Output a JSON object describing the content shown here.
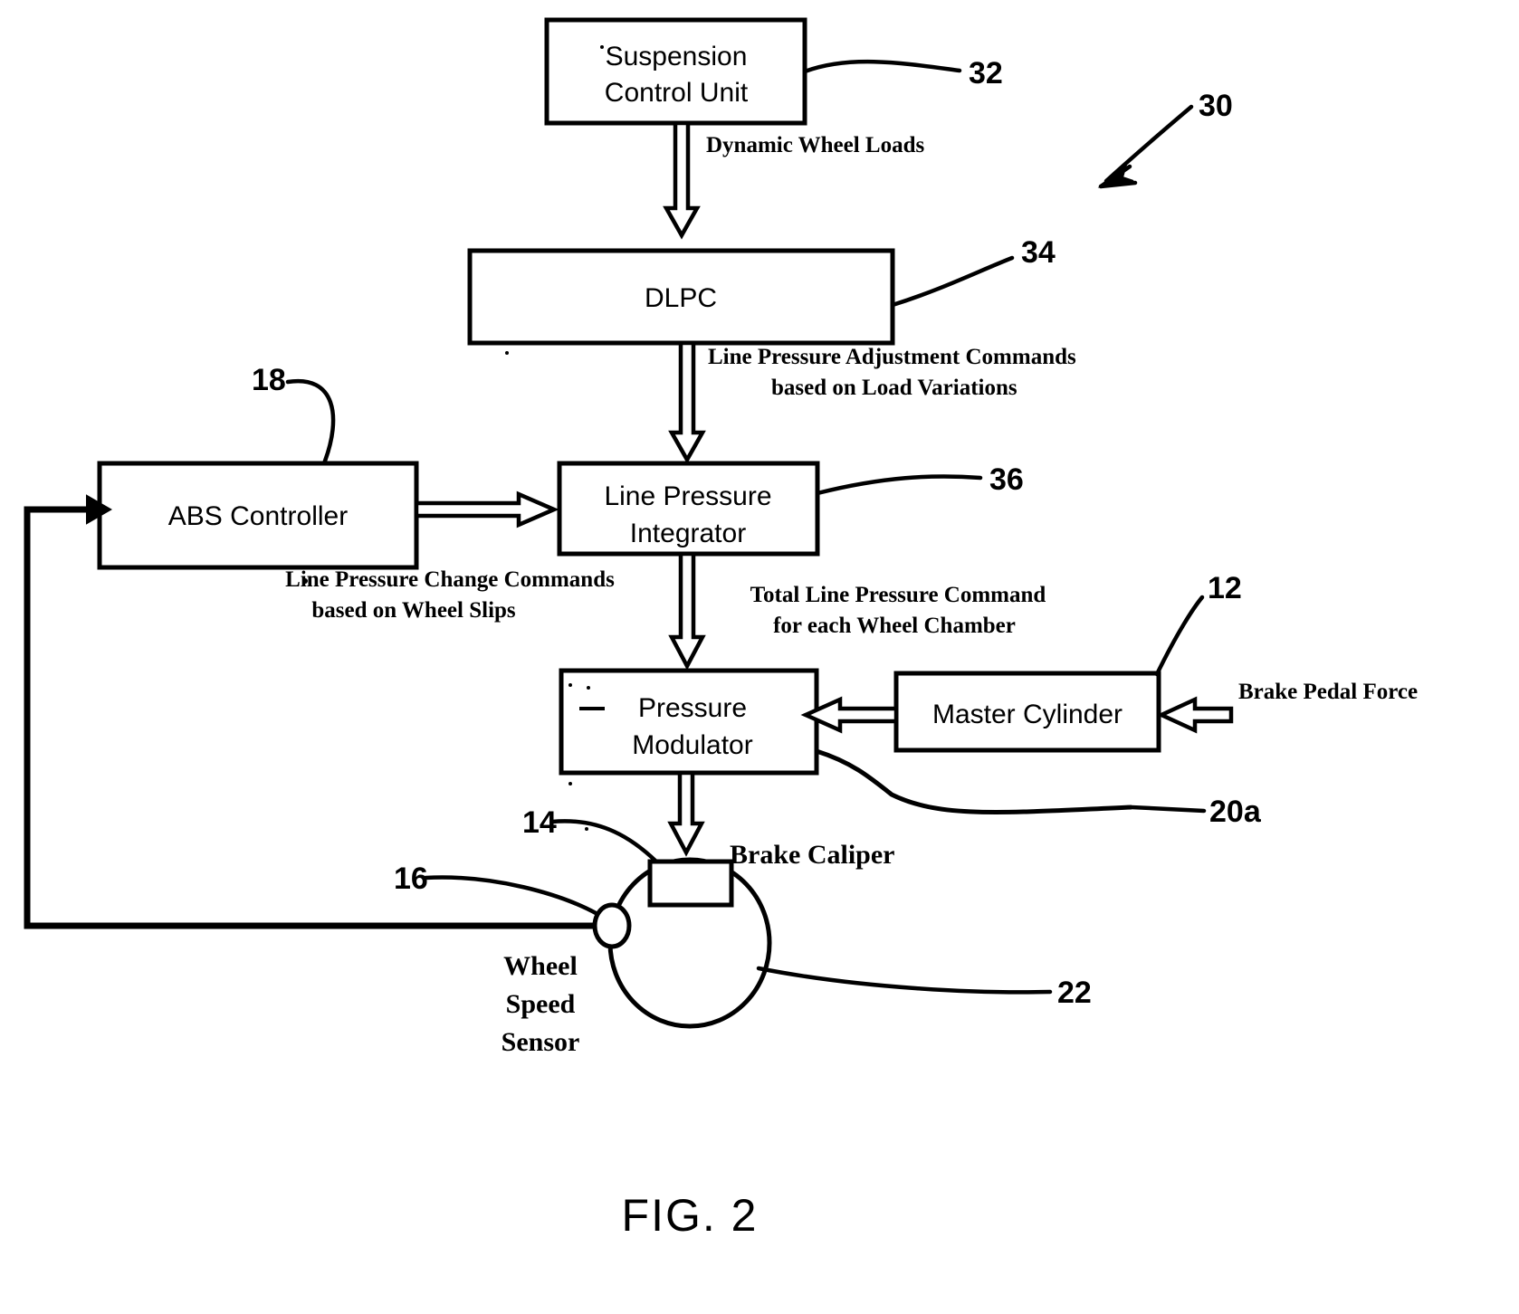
{
  "figure": {
    "caption": "FIG. 2",
    "overall_ref": "30"
  },
  "blocks": [
    {
      "id": "suspension-control-unit",
      "label_line1": "Suspension",
      "label_line2": "Control Unit",
      "ref": "32"
    },
    {
      "id": "dlpc",
      "label_line1": "DLPC",
      "label_line2": "",
      "ref": "34"
    },
    {
      "id": "abs-controller",
      "label_line1": "ABS Controller",
      "label_line2": "",
      "ref": "18"
    },
    {
      "id": "line-pressure-integrator",
      "label_line1": "Line Pressure",
      "label_line2": "Integrator",
      "ref": "36"
    },
    {
      "id": "pressure-modulator",
      "label_line1": "Pressure",
      "label_line2": "Modulator",
      "ref": ""
    },
    {
      "id": "master-cylinder",
      "label_line1": "Master Cylinder",
      "label_line2": "",
      "ref": "12"
    }
  ],
  "flows": [
    {
      "id": "dynamic-wheel-loads",
      "line1": "Dynamic Wheel Loads",
      "line2": ""
    },
    {
      "id": "line-pressure-adjustment",
      "line1": "Line Pressure Adjustment Commands",
      "line2": "based on Load Variations"
    },
    {
      "id": "line-pressure-change",
      "line1": "Line Pressure Change Commands",
      "line2": "based on Wheel Slips"
    },
    {
      "id": "total-line-pressure",
      "line1": "Total Line Pressure Command",
      "line2": "for each Wheel Chamber"
    },
    {
      "id": "brake-pedal-force",
      "line1": "Brake Pedal Force",
      "line2": ""
    }
  ],
  "components": {
    "brake_caliper": {
      "label": "Brake Caliper",
      "ref": "14"
    },
    "wheel_speed_sensor": {
      "label_line1": "Wheel",
      "label_line2": "Speed",
      "label_line3": "Sensor",
      "ref": "16"
    },
    "wheel": {
      "ref": "22"
    },
    "brake_line": {
      "ref": "20a"
    }
  },
  "colors": {
    "ink": "#000000",
    "paper": "#ffffff"
  }
}
